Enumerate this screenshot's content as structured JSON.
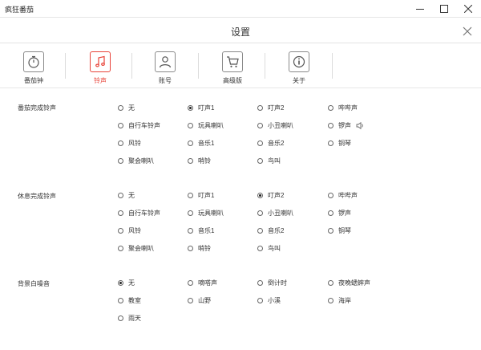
{
  "window": {
    "app_title": "疯狂番茄",
    "minimize_icon": "minimize-icon",
    "maximize_icon": "maximize-icon",
    "close_icon": "close-icon"
  },
  "page": {
    "title": "设置",
    "close_icon": "close-x-icon"
  },
  "tabs": [
    {
      "label": "番茄钟",
      "icon": "stopwatch-icon",
      "active": false
    },
    {
      "label": "铃声",
      "icon": "music-note-icon",
      "active": true
    },
    {
      "label": "账号",
      "icon": "user-icon",
      "active": false
    },
    {
      "label": "高级版",
      "icon": "cart-icon",
      "active": false
    },
    {
      "label": "关于",
      "icon": "info-icon",
      "active": false
    }
  ],
  "sections": [
    {
      "label": "番茄完成铃声",
      "options": [
        "无",
        "叮声1",
        "叮声2",
        "哔哔声",
        "自行车铃声",
        "玩具喇叭",
        "小丑喇叭",
        "锣声",
        "风铃",
        "音乐1",
        "音乐2",
        "铜琴",
        "聚会喇叭",
        "哨铃",
        "鸟叫"
      ],
      "selected": "叮声1"
    },
    {
      "label": "休息完成铃声",
      "options": [
        "无",
        "叮声1",
        "叮声2",
        "哔哔声",
        "自行车铃声",
        "玩具喇叭",
        "小丑喇叭",
        "锣声",
        "风铃",
        "音乐1",
        "音乐2",
        "铜琴",
        "聚会喇叭",
        "哨铃",
        "鸟叫"
      ],
      "selected": "叮声2"
    },
    {
      "label": "背景白噪音",
      "options": [
        "无",
        "嘀嗒声",
        "倒计时",
        "夜晚蟋蟀声",
        "教室",
        "山野",
        "小溪",
        "海岸",
        "雨天"
      ],
      "selected": "无"
    }
  ],
  "speaker_icon": "speaker-icon"
}
